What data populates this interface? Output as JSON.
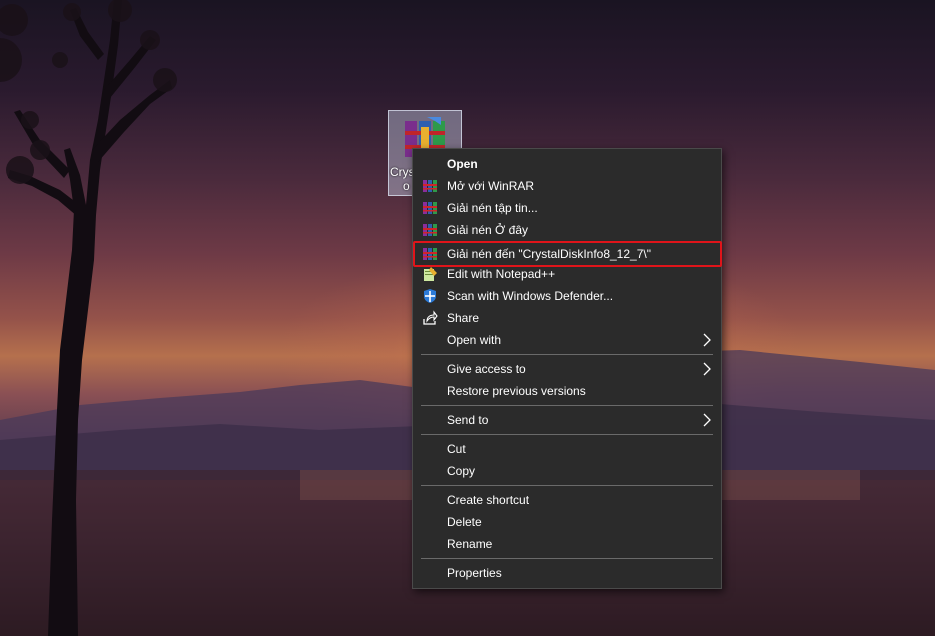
{
  "desktop_icon": {
    "label_line1": "Crys",
    "label_line2": "o"
  },
  "context_menu": {
    "open": "Open",
    "open_with_winrar": "Mở với WinRAR",
    "extract_files": "Giải nén tập tin...",
    "extract_here": "Giải nén Ở đây",
    "extract_to": "Giải nén đến \"CrystalDiskInfo8_12_7\\\"",
    "edit_notepad": "Edit with Notepad++",
    "scan_defender": "Scan with Windows Defender...",
    "share": "Share",
    "open_with": "Open with",
    "give_access": "Give access to",
    "restore_versions": "Restore previous versions",
    "send_to": "Send to",
    "cut": "Cut",
    "copy": "Copy",
    "create_shortcut": "Create shortcut",
    "delete": "Delete",
    "rename": "Rename",
    "properties": "Properties"
  },
  "colors": {
    "menu_bg": "#2b2b2b",
    "highlight_border": "#e0141a",
    "text": "#ffffff"
  }
}
